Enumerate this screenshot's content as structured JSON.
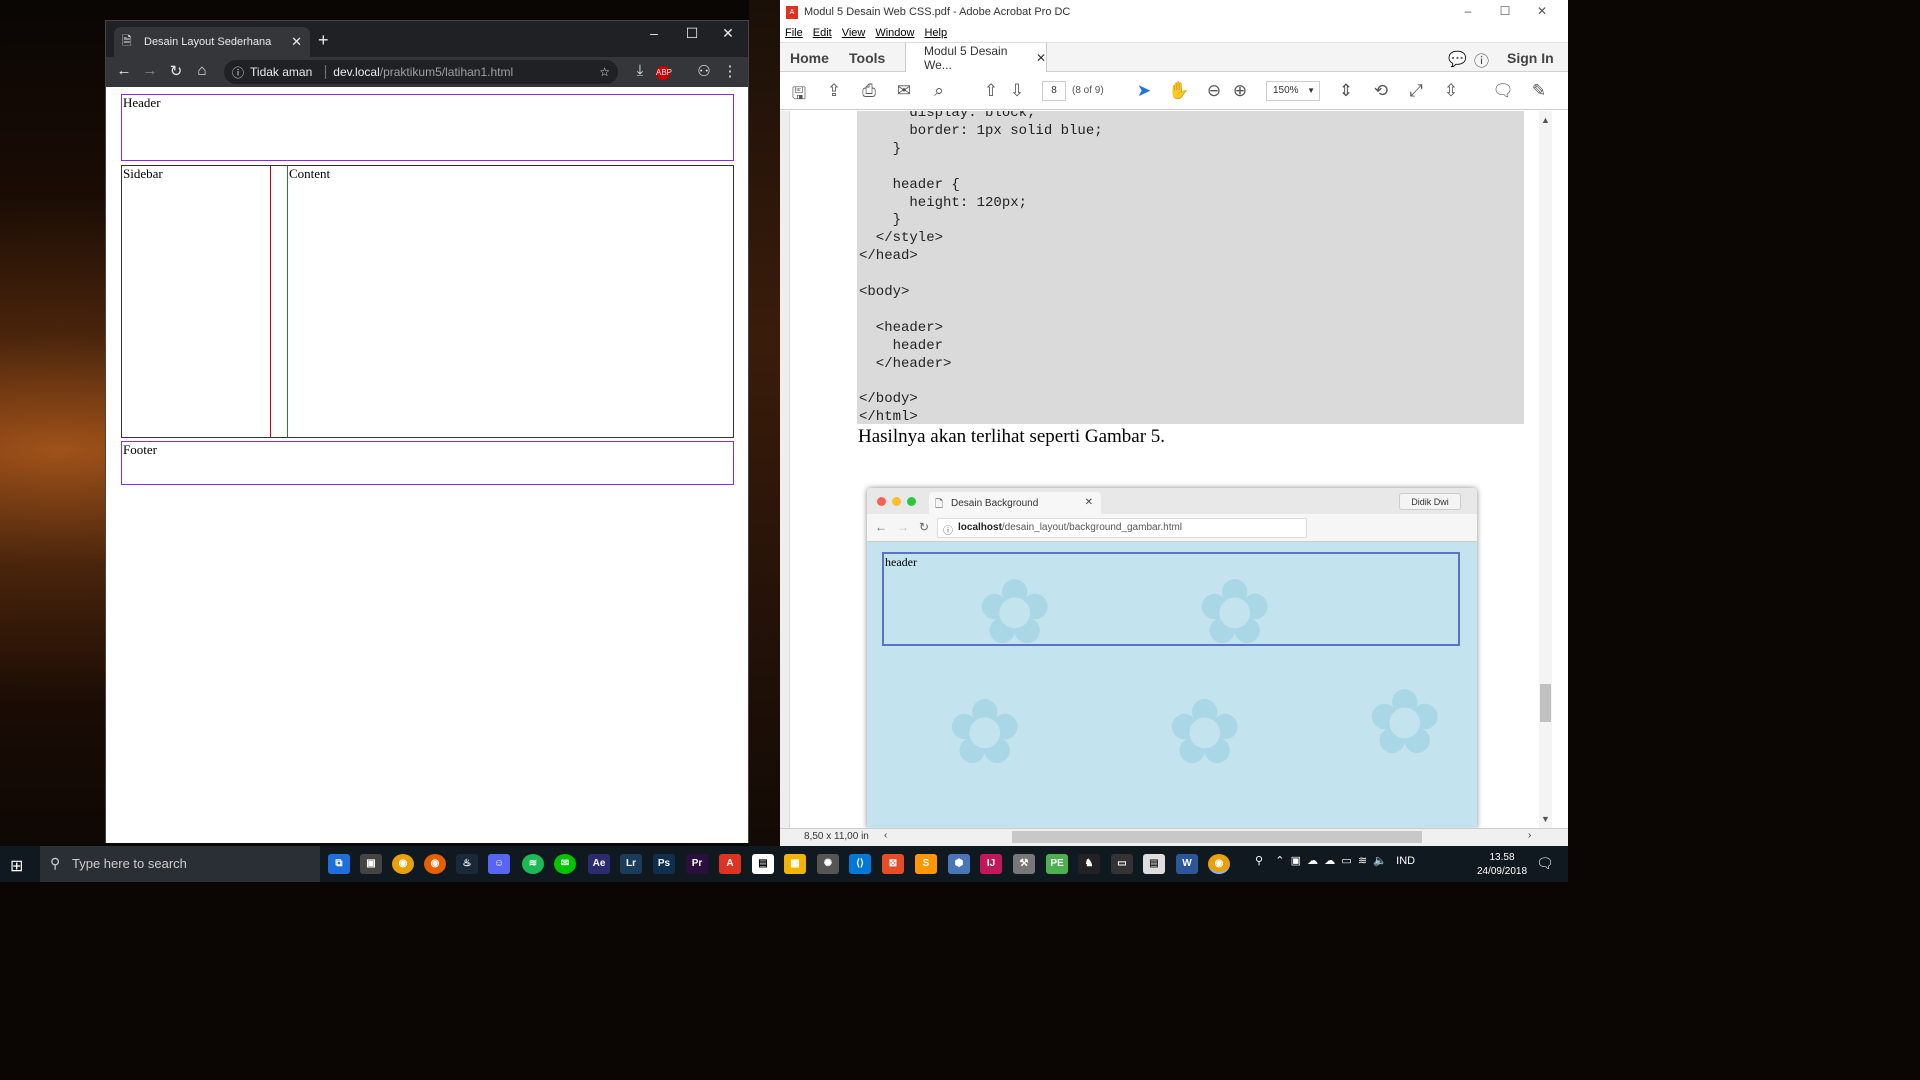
{
  "chrome": {
    "tab_title": "Desain Layout Sederhana",
    "url_security": "Tidak aman",
    "url_host": "dev.local",
    "url_path": "/praktikum5/latihan1.html",
    "page": {
      "header": "Header",
      "sidebar": "Sidebar",
      "content": "Content",
      "footer": "Footer"
    },
    "colors": {
      "header_border": "#8a2be2",
      "sidebar_border": "#d0021b",
      "content_border": "#1f8a1f",
      "footer_border": "#8a2be2"
    }
  },
  "acrobat": {
    "window_title": "Modul 5 Desain Web CSS.pdf - Adobe Acrobat Pro DC",
    "menu": [
      "File",
      "Edit",
      "View",
      "Window",
      "Help"
    ],
    "home_tab": "Home",
    "tools_tab": "Tools",
    "doc_tab": "Modul 5 Desain We...",
    "sign_in": "Sign In",
    "page_number": "8",
    "page_of": "(8 of 9)",
    "zoom": "150%",
    "code_lines": [
      "      display: block;",
      "      border: 1px solid blue;",
      "    }",
      "",
      "    header {",
      "      height: 120px;",
      "    }",
      "  </style>",
      "</head>",
      "",
      "<body>",
      "",
      "  <header>",
      "    header",
      "  </header>",
      "",
      "</body>",
      "</html>"
    ],
    "body_text": "Hasilnya  akan terlihat  seperti Gambar 5.",
    "figure": {
      "tab_title": "Desain Background",
      "user": "Didik Dwi",
      "url_host": "localhost",
      "url_path": "/desain_layout/background_gambar.html",
      "header_text": "header"
    },
    "page_size": "8,50 x 11,00 in"
  },
  "taskbar": {
    "search_placeholder": "Type here to search",
    "language": "IND",
    "time": "13.58",
    "date": "24/09/2018",
    "apps": [
      {
        "name": "Ae",
        "color": "#2b2b6e"
      },
      {
        "name": "Lr",
        "color": "#1c3d5a"
      },
      {
        "name": "Ps",
        "color": "#0f2f4f"
      },
      {
        "name": "Pr",
        "color": "#2c0f3e"
      }
    ]
  }
}
